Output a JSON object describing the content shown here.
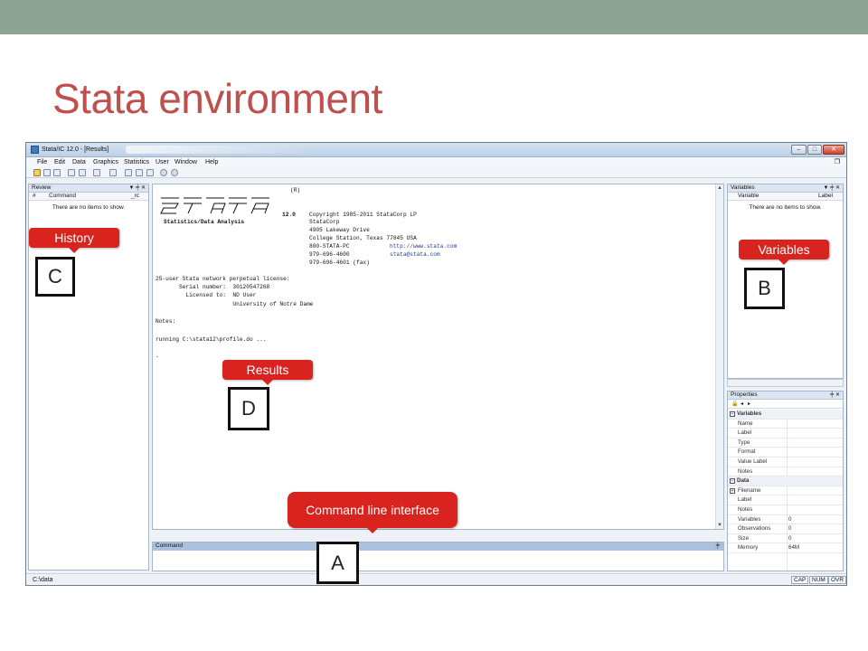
{
  "slide": {
    "title": "Stata environment"
  },
  "window": {
    "title": "Stata/IC 12.0 - [Results]",
    "menu": [
      "File",
      "Edit",
      "Data",
      "Graphics",
      "Statistics",
      "User",
      "Window",
      "Help"
    ],
    "buttons": {
      "minimize": "–",
      "maximize": "□",
      "close": "✕",
      "restore": "❐"
    }
  },
  "review": {
    "title": "Review",
    "controls": "▼ ╪ ✕",
    "columns": [
      "#",
      "Command",
      "_rc"
    ],
    "empty": "There are no items to show."
  },
  "variables": {
    "title": "Variables",
    "controls": "▼ ╪ ✕",
    "columns": [
      "Variable",
      "Label"
    ],
    "empty": "There are no items to show."
  },
  "properties": {
    "title": "Properties",
    "controls": "╪ ✕",
    "sections": [
      {
        "name": "Variables",
        "rows": [
          {
            "k": "Name",
            "v": ""
          },
          {
            "k": "Label",
            "v": ""
          },
          {
            "k": "Type",
            "v": ""
          },
          {
            "k": "Format",
            "v": ""
          },
          {
            "k": "Value Label",
            "v": ""
          },
          {
            "k": "Notes",
            "v": ""
          }
        ]
      },
      {
        "name": "Data",
        "rows": [
          {
            "k": "Filename",
            "v": ""
          },
          {
            "k": "Label",
            "v": ""
          },
          {
            "k": "Notes",
            "v": ""
          },
          {
            "k": "Variables",
            "v": "0"
          },
          {
            "k": "Observations",
            "v": "0"
          },
          {
            "k": "Size",
            "v": "0"
          },
          {
            "k": "Memory",
            "v": "64M"
          }
        ]
      }
    ]
  },
  "results": {
    "logo_reg": "(R)",
    "header_left": "Statistics/Data Analysis",
    "version": "12.0",
    "copyright": "Copyright 1985-2011 StataCorp LP",
    "corp": "StataCorp",
    "street": "4905 Lakeway Drive",
    "city": "College Station, Texas 77845 USA",
    "phone1": "800-STATA-PC",
    "url": "http://www.stata.com",
    "phone2": "979-696-4600",
    "email": "stata@stata.com",
    "fax": "979-696-4601 (fax)",
    "license": "25-user Stata network perpetual license:",
    "serial": "       Serial number:  30120547268",
    "licensed_to": "         Licensed to:  ND User",
    "university": "                       University of Notre Dame",
    "notes": "Notes:",
    "running": "running C:\\stata12\\profile.do ...",
    "prompt": "."
  },
  "command": {
    "title": "Command",
    "pin": "╪"
  },
  "status": {
    "path": "C:\\data",
    "indicators": [
      "CAP",
      "NUM",
      "OVR"
    ]
  },
  "callouts": {
    "history": "History",
    "variables": "Variables",
    "results": "Results",
    "command": "Command line interface"
  },
  "letters": {
    "a": "A",
    "b": "B",
    "c": "C",
    "d": "D"
  },
  "colors": {
    "accent_title": "#c0504d",
    "callout": "#d9231e",
    "topbar": "#8ea394"
  }
}
